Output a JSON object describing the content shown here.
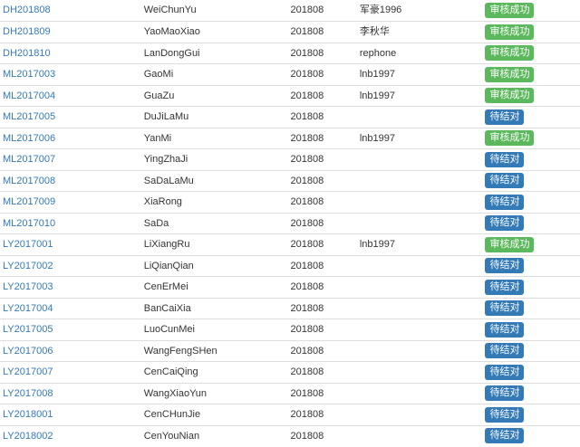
{
  "colors": {
    "link": "#337ab7",
    "approved": "#5cb85c",
    "pending": "#337ab7"
  },
  "rows": [
    {
      "id": "DH201808",
      "name": "WeiChunYu",
      "period": "201808",
      "reviewer": "军豪1996",
      "status": "审核成功",
      "status_type": "approved"
    },
    {
      "id": "DH201809",
      "name": "YaoMaoXiao",
      "period": "201808",
      "reviewer": "李秋华",
      "status": "审核成功",
      "status_type": "approved"
    },
    {
      "id": "DH201810",
      "name": "LanDongGui",
      "period": "201808",
      "reviewer": "rephone",
      "status": "审核成功",
      "status_type": "approved"
    },
    {
      "id": "ML2017003",
      "name": "GaoMi",
      "period": "201808",
      "reviewer": "lnb1997",
      "status": "审核成功",
      "status_type": "approved"
    },
    {
      "id": "ML2017004",
      "name": "GuaZu",
      "period": "201808",
      "reviewer": "lnb1997",
      "status": "审核成功",
      "status_type": "approved"
    },
    {
      "id": "ML2017005",
      "name": "DuJiLaMu",
      "period": "201808",
      "reviewer": "",
      "status": "待结对",
      "status_type": "pending"
    },
    {
      "id": "ML2017006",
      "name": "YanMi",
      "period": "201808",
      "reviewer": "lnb1997",
      "status": "审核成功",
      "status_type": "approved"
    },
    {
      "id": "ML2017007",
      "name": "YingZhaJi",
      "period": "201808",
      "reviewer": "",
      "status": "待结对",
      "status_type": "pending"
    },
    {
      "id": "ML2017008",
      "name": "SaDaLaMu",
      "period": "201808",
      "reviewer": "",
      "status": "待结对",
      "status_type": "pending"
    },
    {
      "id": "ML2017009",
      "name": "XiaRong",
      "period": "201808",
      "reviewer": "",
      "status": "待结对",
      "status_type": "pending"
    },
    {
      "id": "ML2017010",
      "name": "SaDa",
      "period": "201808",
      "reviewer": "",
      "status": "待结对",
      "status_type": "pending"
    },
    {
      "id": "LY2017001",
      "name": "LiXiangRu",
      "period": "201808",
      "reviewer": "lnb1997",
      "status": "审核成功",
      "status_type": "approved"
    },
    {
      "id": "LY2017002",
      "name": "LiQianQian",
      "period": "201808",
      "reviewer": "",
      "status": "待结对",
      "status_type": "pending"
    },
    {
      "id": "LY2017003",
      "name": "CenErMei",
      "period": "201808",
      "reviewer": "",
      "status": "待结对",
      "status_type": "pending"
    },
    {
      "id": "LY2017004",
      "name": "BanCaiXia",
      "period": "201808",
      "reviewer": "",
      "status": "待结对",
      "status_type": "pending"
    },
    {
      "id": "LY2017005",
      "name": "LuoCunMei",
      "period": "201808",
      "reviewer": "",
      "status": "待结对",
      "status_type": "pending"
    },
    {
      "id": "LY2017006",
      "name": "WangFengSHen",
      "period": "201808",
      "reviewer": "",
      "status": "待结对",
      "status_type": "pending"
    },
    {
      "id": "LY2017007",
      "name": "CenCaiQing",
      "period": "201808",
      "reviewer": "",
      "status": "待结对",
      "status_type": "pending"
    },
    {
      "id": "LY2017008",
      "name": "WangXiaoYun",
      "period": "201808",
      "reviewer": "",
      "status": "待结对",
      "status_type": "pending"
    },
    {
      "id": "LY2018001",
      "name": "CenCHunJie",
      "period": "201808",
      "reviewer": "",
      "status": "待结对",
      "status_type": "pending"
    },
    {
      "id": "LY2018002",
      "name": "CenYouNian",
      "period": "201808",
      "reviewer": "",
      "status": "待结对",
      "status_type": "pending"
    }
  ]
}
